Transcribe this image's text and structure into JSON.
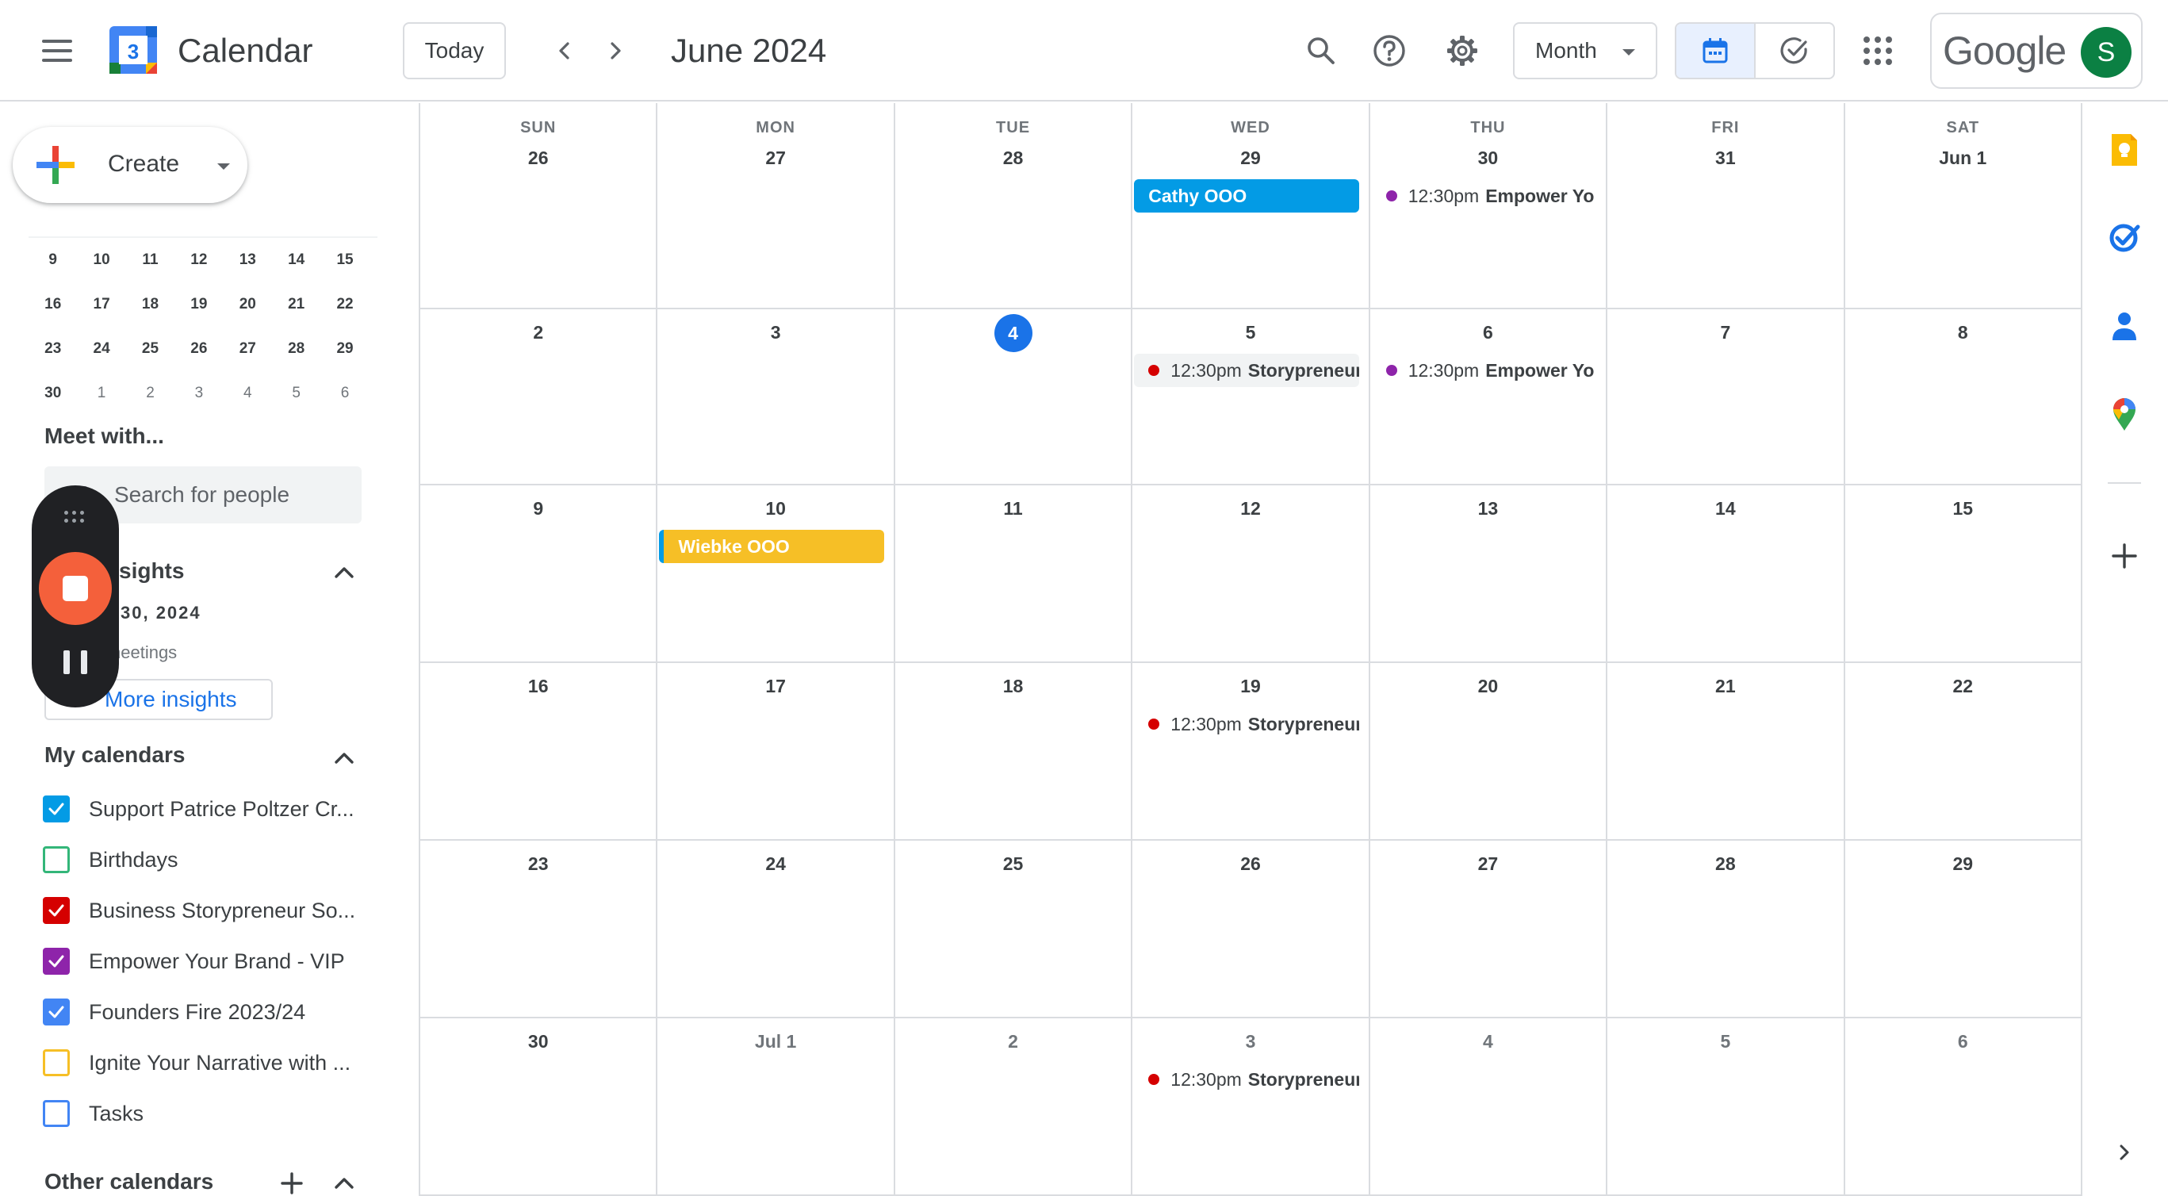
{
  "header": {
    "app_title": "Calendar",
    "logo_day": "3",
    "today_label": "Today",
    "month_title": "June 2024",
    "view_label": "Month",
    "google_label": "Google",
    "avatar_initial": "S"
  },
  "sidebar": {
    "create_label": "Create",
    "mini_calendar": [
      [
        {
          "d": "9"
        },
        {
          "d": "10"
        },
        {
          "d": "11"
        },
        {
          "d": "12"
        },
        {
          "d": "13"
        },
        {
          "d": "14"
        },
        {
          "d": "15"
        }
      ],
      [
        {
          "d": "16"
        },
        {
          "d": "17"
        },
        {
          "d": "18"
        },
        {
          "d": "19"
        },
        {
          "d": "20"
        },
        {
          "d": "21"
        },
        {
          "d": "22"
        }
      ],
      [
        {
          "d": "23"
        },
        {
          "d": "24"
        },
        {
          "d": "25"
        },
        {
          "d": "26"
        },
        {
          "d": "27"
        },
        {
          "d": "28"
        },
        {
          "d": "29"
        }
      ],
      [
        {
          "d": "30"
        },
        {
          "d": "1",
          "other": true
        },
        {
          "d": "2",
          "other": true
        },
        {
          "d": "3",
          "other": true
        },
        {
          "d": "4",
          "other": true
        },
        {
          "d": "5",
          "other": true
        },
        {
          "d": "6",
          "other": true
        }
      ]
    ],
    "meet_with_title": "Meet with...",
    "search_people_placeholder": "Search for people",
    "insights_title": "sights",
    "insights_date": "30, 2024",
    "insights_sub": "neetings",
    "more_insights_label": "More insights",
    "my_calendars_title": "My calendars",
    "calendars": [
      {
        "name": "Support Patrice Poltzer Cr...",
        "color": "#039be5",
        "checked": true
      },
      {
        "name": "Birthdays",
        "color": "#33b679",
        "checked": false
      },
      {
        "name": "Business Storypreneur So...",
        "color": "#d50000",
        "checked": true
      },
      {
        "name": "Empower Your Brand - VIP",
        "color": "#8e24aa",
        "checked": true
      },
      {
        "name": "Founders Fire 2023/24",
        "color": "#4285f4",
        "checked": true
      },
      {
        "name": "Ignite Your Narrative with ...",
        "color": "#f6bf26",
        "checked": false
      },
      {
        "name": "Tasks",
        "color": "#4285f4",
        "checked": false
      }
    ],
    "other_calendars_title": "Other calendars"
  },
  "grid": {
    "weekdays": [
      "SUN",
      "MON",
      "TUE",
      "WED",
      "THU",
      "FRI",
      "SAT"
    ],
    "weeks": [
      [
        {
          "d": "26"
        },
        {
          "d": "27"
        },
        {
          "d": "28"
        },
        {
          "d": "29"
        },
        {
          "d": "30"
        },
        {
          "d": "31"
        },
        {
          "d": "Jun 1"
        }
      ],
      [
        {
          "d": "2"
        },
        {
          "d": "3"
        },
        {
          "d": "4",
          "today": true
        },
        {
          "d": "5"
        },
        {
          "d": "6"
        },
        {
          "d": "7"
        },
        {
          "d": "8"
        }
      ],
      [
        {
          "d": "9"
        },
        {
          "d": "10"
        },
        {
          "d": "11"
        },
        {
          "d": "12"
        },
        {
          "d": "13"
        },
        {
          "d": "14"
        },
        {
          "d": "15"
        }
      ],
      [
        {
          "d": "16"
        },
        {
          "d": "17"
        },
        {
          "d": "18"
        },
        {
          "d": "19"
        },
        {
          "d": "20"
        },
        {
          "d": "21"
        },
        {
          "d": "22"
        }
      ],
      [
        {
          "d": "23"
        },
        {
          "d": "24"
        },
        {
          "d": "25"
        },
        {
          "d": "26"
        },
        {
          "d": "27"
        },
        {
          "d": "28"
        },
        {
          "d": "29"
        }
      ],
      [
        {
          "d": "30"
        },
        {
          "d": "Jul 1",
          "other": true
        },
        {
          "d": "2",
          "other": true
        },
        {
          "d": "3",
          "other": true
        },
        {
          "d": "4",
          "other": true
        },
        {
          "d": "5",
          "other": true
        },
        {
          "d": "6",
          "other": true
        }
      ]
    ],
    "events": [
      {
        "week": 0,
        "day": 3,
        "kind": "allday",
        "title": "Cathy OOO",
        "color": "#039be5"
      },
      {
        "week": 0,
        "day": 4,
        "kind": "timed",
        "time": "12:30pm",
        "title": "Empower Yo",
        "color": "#8e24aa"
      },
      {
        "week": 1,
        "day": 3,
        "kind": "timed",
        "time": "12:30pm",
        "title": "Storypreneur",
        "color": "#d50000",
        "shaded": true
      },
      {
        "week": 1,
        "day": 4,
        "kind": "timed",
        "time": "12:30pm",
        "title": "Empower Yo",
        "color": "#8e24aa"
      },
      {
        "week": 2,
        "day": 1,
        "kind": "allday",
        "title": "Wiebke OOO",
        "color": "#f6bf26",
        "accent": "#039be5"
      },
      {
        "week": 3,
        "day": 3,
        "kind": "timed",
        "time": "12:30pm",
        "title": "Storypreneur",
        "color": "#d50000"
      },
      {
        "week": 5,
        "day": 3,
        "kind": "timed",
        "time": "12:30pm",
        "title": "Storypreneur",
        "color": "#d50000"
      }
    ]
  },
  "side_panel": {
    "icons": [
      "keep-icon",
      "tasks-icon",
      "contacts-icon",
      "maps-icon",
      "add-icon",
      "chevron-right-icon"
    ]
  },
  "recorder": {
    "icons": [
      "drag-handle-icon",
      "stop-icon",
      "pause-icon"
    ]
  }
}
